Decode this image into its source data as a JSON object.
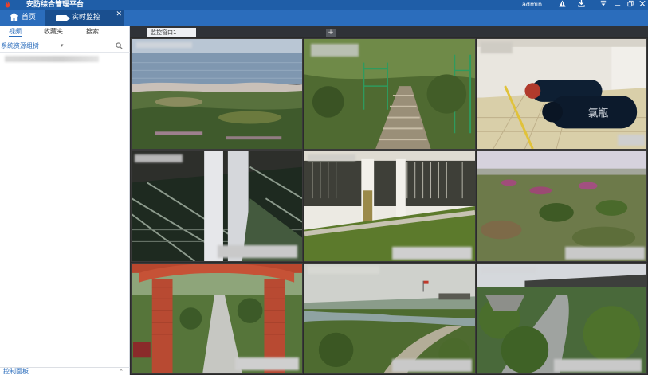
{
  "app": {
    "title": "安防综合管理平台",
    "user": "admin",
    "icons": {
      "logo": "flame-logo-icon",
      "warning": "warning-icon",
      "download": "download-icon",
      "menu": "menu-icon",
      "minimize": "minimize-icon",
      "restore": "restore-icon",
      "close": "close-icon"
    }
  },
  "nav": {
    "home_label": "首页",
    "monitor_label": "实时监控",
    "close_glyph": "✕"
  },
  "sidebar": {
    "tabs": [
      "视频",
      "收藏夹",
      "搜索"
    ],
    "active_tab": "视频",
    "filter_label": "系统资源组树",
    "filter_dropdown": "▾",
    "footer_label": "控制面板"
  },
  "view": {
    "tab_label": "监控窗口1",
    "add_glyph": "+"
  },
  "colors": {
    "titlebar": "#1f5ea8",
    "navbar": "#2b6dbc",
    "nav_active": "#1a4f8f",
    "accent": "#2b6dbc",
    "grid_bg": "#2b2b2b"
  },
  "grid": {
    "rows": 3,
    "cols": 3,
    "cells": [
      {
        "scene": "riverbank"
      },
      {
        "scene": "hillside-path-fence"
      },
      {
        "scene": "gas-cylinders-room",
        "cylinder_text": "氯瓶"
      },
      {
        "scene": "water-tank-pillars"
      },
      {
        "scene": "filter-gallery"
      },
      {
        "scene": "grassland-shrubs"
      },
      {
        "scene": "brick-arch-path"
      },
      {
        "scene": "river-facility-distance"
      },
      {
        "scene": "treatment-ponds"
      }
    ]
  }
}
